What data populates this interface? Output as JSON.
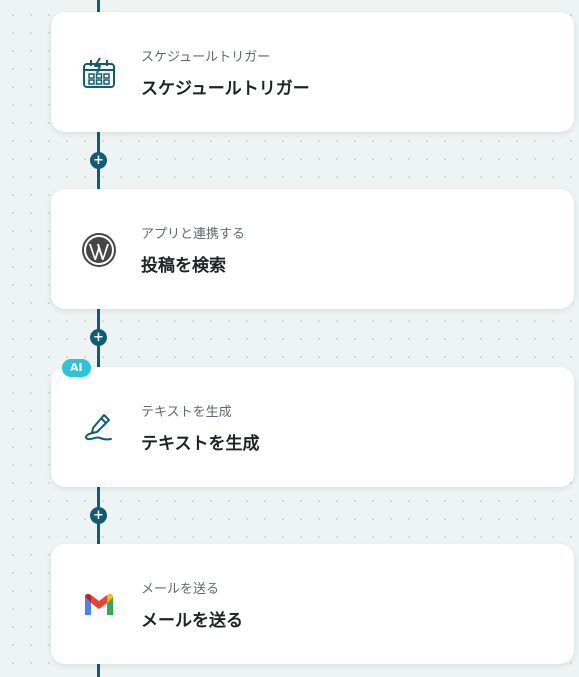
{
  "colors": {
    "connector": "#0f5c75",
    "ai_badge": "#2cc4d9",
    "card_background": "#ffffff",
    "canvas_background": "#eef3f4"
  },
  "steps": [
    {
      "subtitle": "スケジュールトリガー",
      "title": "スケジュールトリガー",
      "icon": "calendar-schedule-icon"
    },
    {
      "subtitle": "アプリと連携する",
      "title": "投稿を検索",
      "icon": "wordpress-icon"
    },
    {
      "subtitle": "テキストを生成",
      "title": "テキストを生成",
      "icon": "pen-write-icon",
      "badge": "AI"
    },
    {
      "subtitle": "メールを送る",
      "title": "メールを送る",
      "icon": "gmail-icon"
    }
  ],
  "add_button_symbol": "+"
}
